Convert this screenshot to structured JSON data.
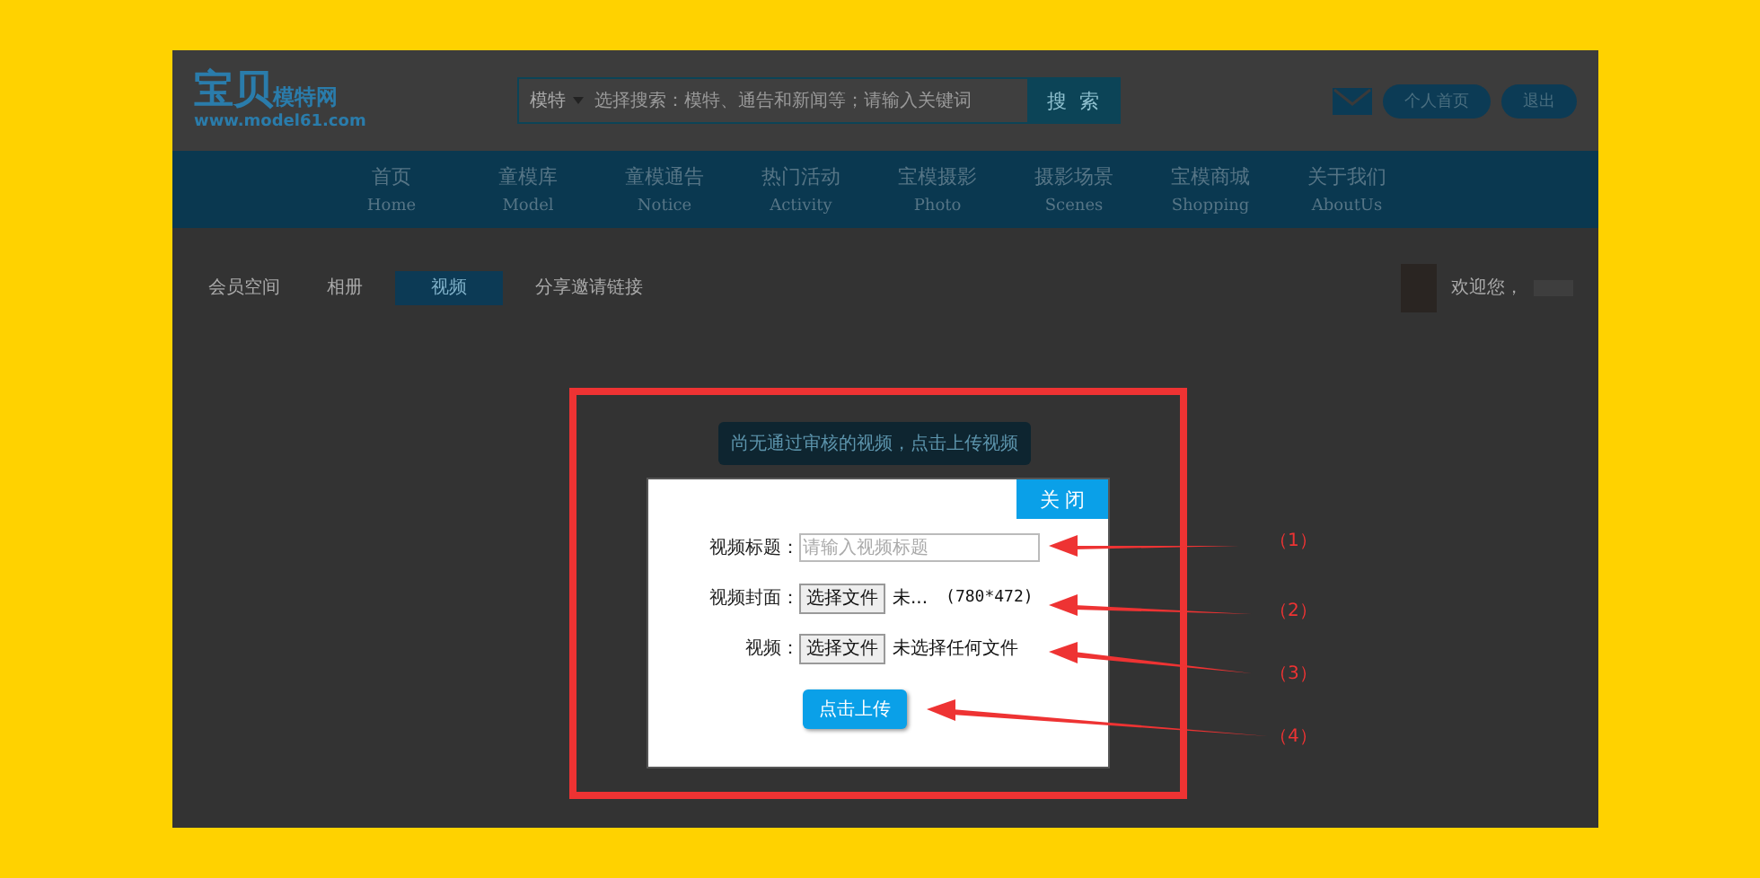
{
  "logo": {
    "title": "宝贝",
    "subtitle": "模特网",
    "url": "www.model61.com"
  },
  "search": {
    "category": "模特",
    "placeholder": "选择搜索：模特、通告和新闻等；请输入关键词",
    "button": "搜 索"
  },
  "header_buttons": [
    "个人首页",
    "退出"
  ],
  "nav": [
    {
      "label": "首页",
      "sub": "Home"
    },
    {
      "label": "童模库",
      "sub": "Model"
    },
    {
      "label": "童模通告",
      "sub": "Notice"
    },
    {
      "label": "热门活动",
      "sub": "Activity"
    },
    {
      "label": "宝模摄影",
      "sub": "Photo"
    },
    {
      "label": "摄影场景",
      "sub": "Scenes"
    },
    {
      "label": "宝模商城",
      "sub": "Shopping"
    },
    {
      "label": "关于我们",
      "sub": "AboutUs"
    }
  ],
  "subnav": [
    {
      "label": "会员空间",
      "selected": false
    },
    {
      "label": "相册",
      "selected": false
    },
    {
      "label": "视频",
      "selected": true
    },
    {
      "label": "分享邀请链接",
      "selected": false
    }
  ],
  "welcome": "欢迎您，",
  "notice": "尚无通过审核的视频，点击上传视频",
  "dialog": {
    "close": "关 闭",
    "fields": [
      {
        "kind": "text",
        "label": "视频标题：",
        "placeholder": "请输入视频标题"
      },
      {
        "kind": "file",
        "label": "视频封面：",
        "button": "选择文件",
        "file": "未...",
        "hint": "(780*472)"
      },
      {
        "kind": "file",
        "label": "视频：",
        "button": "选择文件",
        "file": "未选择任何文件"
      }
    ],
    "submit": "点击上传"
  },
  "callouts": [
    "（1）",
    "（2）",
    "（3）",
    "（4）"
  ]
}
